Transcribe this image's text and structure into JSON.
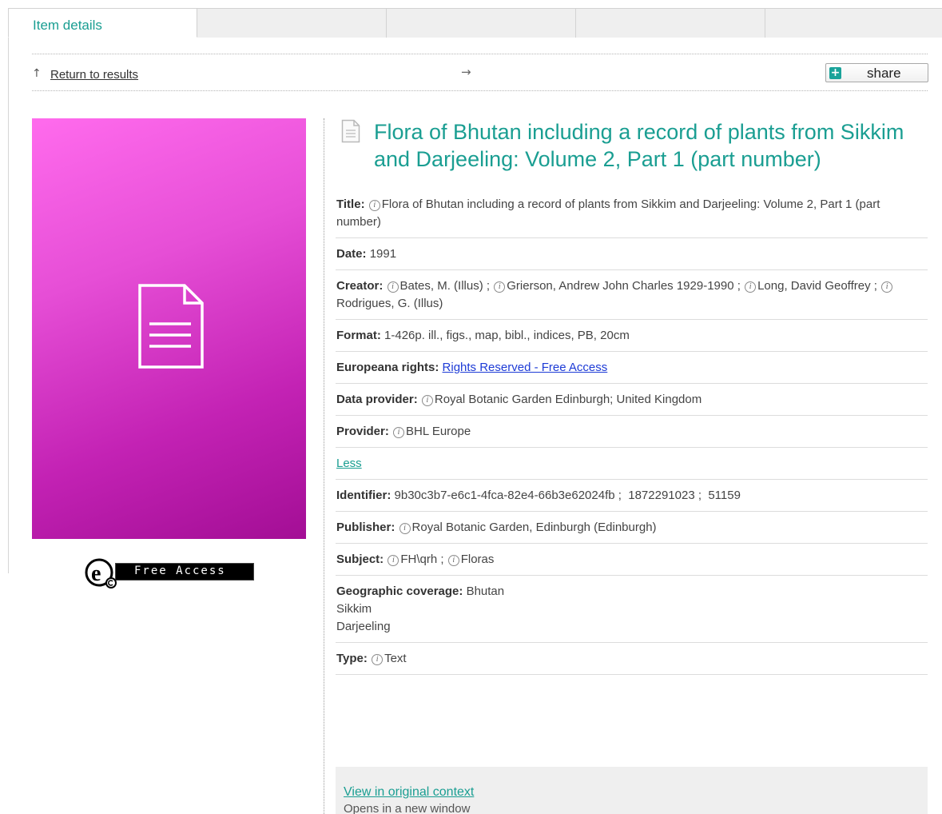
{
  "tabs": [
    {
      "label": "Item details",
      "active": true
    },
    {
      "label": ""
    },
    {
      "label": ""
    },
    {
      "label": ""
    },
    {
      "label": ""
    }
  ],
  "nav": {
    "up_arrow": "↑",
    "return_label": "Return to results",
    "next_arrow": "→",
    "share_label": "share",
    "share_icon": "plus-icon"
  },
  "thumbnail": {
    "icon": "document-icon",
    "rights_badge_label": "Free Access",
    "rights_badge_logo": "e"
  },
  "item": {
    "title": "Flora of Bhutan including a record of plants from Sikkim and Darjeeling: Volume 2, Part 1 (part number)",
    "fields": {
      "title": {
        "label": "Title:",
        "value": "Flora of Bhutan including a record of plants from Sikkim and Darjeeling: Volume 2, Part 1 (part number)"
      },
      "date": {
        "label": "Date:",
        "value": "1991"
      },
      "creator": {
        "label": "Creator:",
        "values": [
          "Bates, M. (Illus)",
          "Grierson, Andrew John Charles 1929-1990",
          "Long, David Geoffrey",
          "Rodrigues, G. (Illus)"
        ],
        "sep": ";"
      },
      "format": {
        "label": "Format:",
        "value": "1-426p. ill., figs., map, bibl., indices, PB, 20cm"
      },
      "rights": {
        "label": "Europeana rights:",
        "value": "Rights Reserved - Free Access"
      },
      "data_provider": {
        "label": "Data provider:",
        "value": "Royal Botanic Garden Edinburgh; United Kingdom"
      },
      "provider": {
        "label": "Provider:",
        "value": "BHL Europe"
      },
      "less": {
        "label": "Less"
      },
      "identifier": {
        "label": "Identifier:",
        "value": "9b30c3b7-e6c1-4fca-82e4-66b3e62024fb ;  1872291023 ;  51159"
      },
      "publisher": {
        "label": "Publisher:",
        "value": "Royal Botanic Garden, Edinburgh (Edinburgh)"
      },
      "subject": {
        "label": "Subject:",
        "values": [
          "FH\\qrh",
          "Floras"
        ]
      },
      "geo": {
        "label": "Geographic coverage:",
        "values": [
          "Bhutan",
          "Sikkim",
          "Darjeeling"
        ]
      },
      "type": {
        "label": "Type:",
        "value": "Text"
      }
    }
  },
  "context": {
    "link_label": "View in original context",
    "sub_label": "Opens in a new window"
  },
  "colors": {
    "accent": "#1a9e92",
    "link": "#1d3bd6",
    "thumb_top": "#ff6bed",
    "thumb_bottom": "#a30e95"
  }
}
